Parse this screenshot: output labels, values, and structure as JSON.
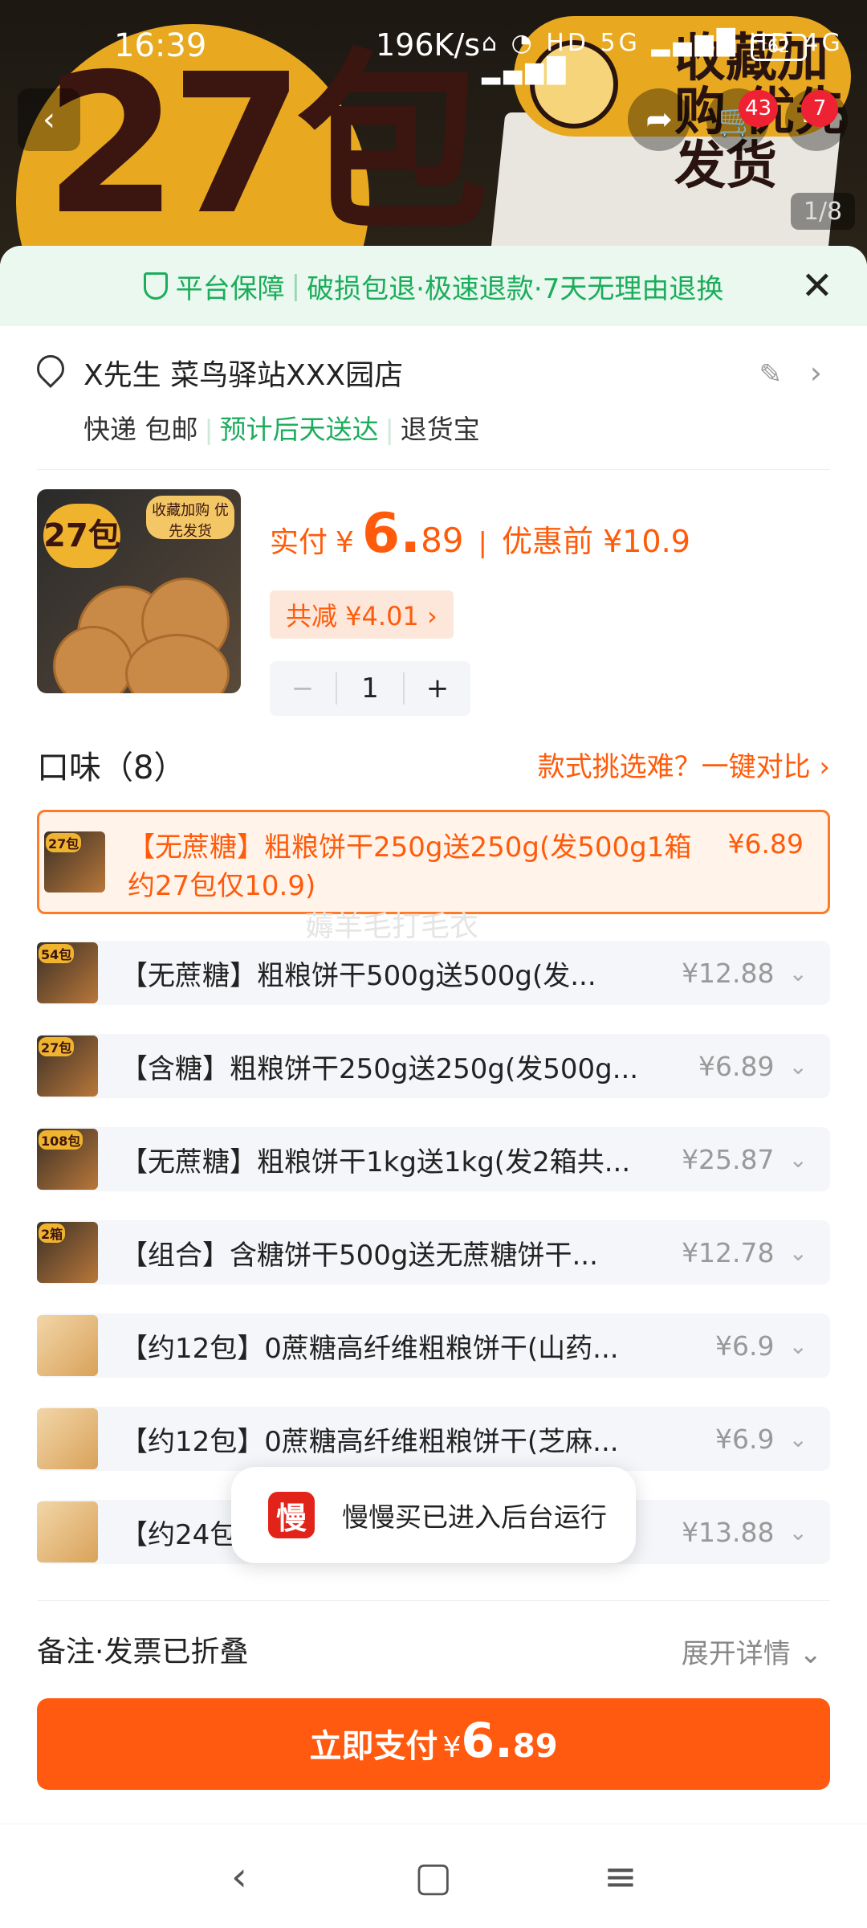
{
  "status_bar": {
    "time": "16:39",
    "net_speed": "196K/s",
    "icons": "⌂ ◔ HD 5G ▂▄▆█ HD 4G ▂▄▆█",
    "battery": "62"
  },
  "header_media": {
    "promo_big_text": "27包",
    "promo_banner_text": "收藏加购 优先发货",
    "cart_badge": "43",
    "more_badge": "7",
    "page_indicator": "1/8"
  },
  "guarantee": {
    "items": [
      "平台保障",
      "破损包退·极速退款·7天无理由退换"
    ]
  },
  "address": {
    "name_line": "X先生 菜鸟驿站XXX园店",
    "shipping": "快递 包邮",
    "delivery": "预计后天送达",
    "service": "退货宝"
  },
  "product": {
    "thumb_tag": "27包",
    "thumb_banner": "收藏加购 优先发货",
    "paid_label": "实付",
    "currency": "¥",
    "price_int": "6.",
    "price_dec": "89",
    "divider": "|",
    "before_label": "优惠前 ¥10.9",
    "savings": "共减 ¥4.01 ›",
    "qty_minus": "−",
    "qty": "1",
    "qty_plus": "+"
  },
  "flavors": {
    "title": "口味（8）",
    "compare": "款式挑选难？一键对比 ›",
    "options": [
      {
        "tag": "27包",
        "text": "【无蔗糖】粗粮饼干250g送250g(发500g1箱约27包仅10.9)",
        "price": "¥6.89",
        "selected": true
      },
      {
        "tag": "54包",
        "text": "【无蔗糖】粗粮饼干500g送500g(发...",
        "price": "¥12.88"
      },
      {
        "tag": "27包",
        "text": "【含糖】粗粮饼干250g送250g(发500g...",
        "price": "¥6.89"
      },
      {
        "tag": "108包",
        "text": "【无蔗糖】粗粮饼干1kg送1kg(发2箱共...",
        "price": "¥25.87"
      },
      {
        "tag": "2箱",
        "text": "【组合】含糖饼干500g送无蔗糖饼干...",
        "price": "¥12.78"
      },
      {
        "tag": "",
        "text": "【约12包】0蔗糖高纤维粗粮饼干(山药...",
        "price": "¥6.9"
      },
      {
        "tag": "",
        "text": "【约12包】0蔗糖高纤维粗粮饼干(芝麻...",
        "price": "¥6.9"
      },
      {
        "tag": "",
        "text": "【约24包】0蔗糖高纤维粗粮饼干(山药...",
        "price": "¥13.88"
      }
    ]
  },
  "watermark": "薅羊毛打毛衣",
  "toast": {
    "icon": "慢",
    "message": "慢慢买已进入后台运行"
  },
  "note": {
    "label": "备注·发票已折叠",
    "expand": "展开详情 ⌄"
  },
  "pay_button": {
    "label": "立即支付",
    "currency": "¥",
    "int": "6.",
    "dec": "89"
  },
  "nav": {
    "back": "‹",
    "home": "▢",
    "menu": "≡"
  },
  "colors": {
    "accent": "#ff5a10",
    "green": "#1bad5b"
  }
}
